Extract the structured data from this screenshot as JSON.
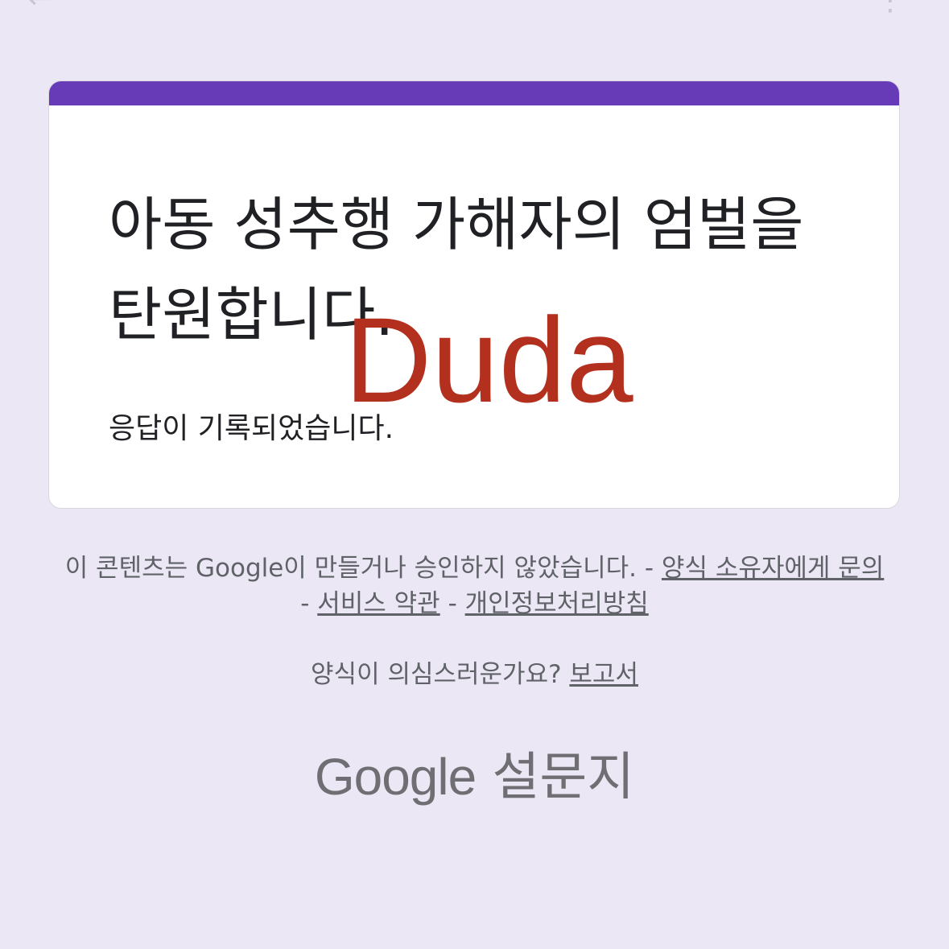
{
  "top_bar": {
    "back_icon": "arrow-left-icon",
    "more_icon": "more-vert-icon"
  },
  "card": {
    "accent_color": "#673ab7",
    "title": "아동 성추행 가해자의 엄벌을 탄원합니다.",
    "message": "응답이 기록되었습니다."
  },
  "watermark": {
    "text": "Duda",
    "color": "#b3301f"
  },
  "footer": {
    "disclaimer": "이 콘텐츠는 Google이 만들거나 승인하지 않았습니다.",
    "sep": " - ",
    "contact_link": "양식 소유자에게 문의",
    "terms_link": "서비스 약관",
    "privacy_link": "개인정보처리방침",
    "report_question": "양식이 의심스러운가요?",
    "report_link": "보고서"
  },
  "brand": {
    "google": "Google",
    "product": "설문지"
  }
}
